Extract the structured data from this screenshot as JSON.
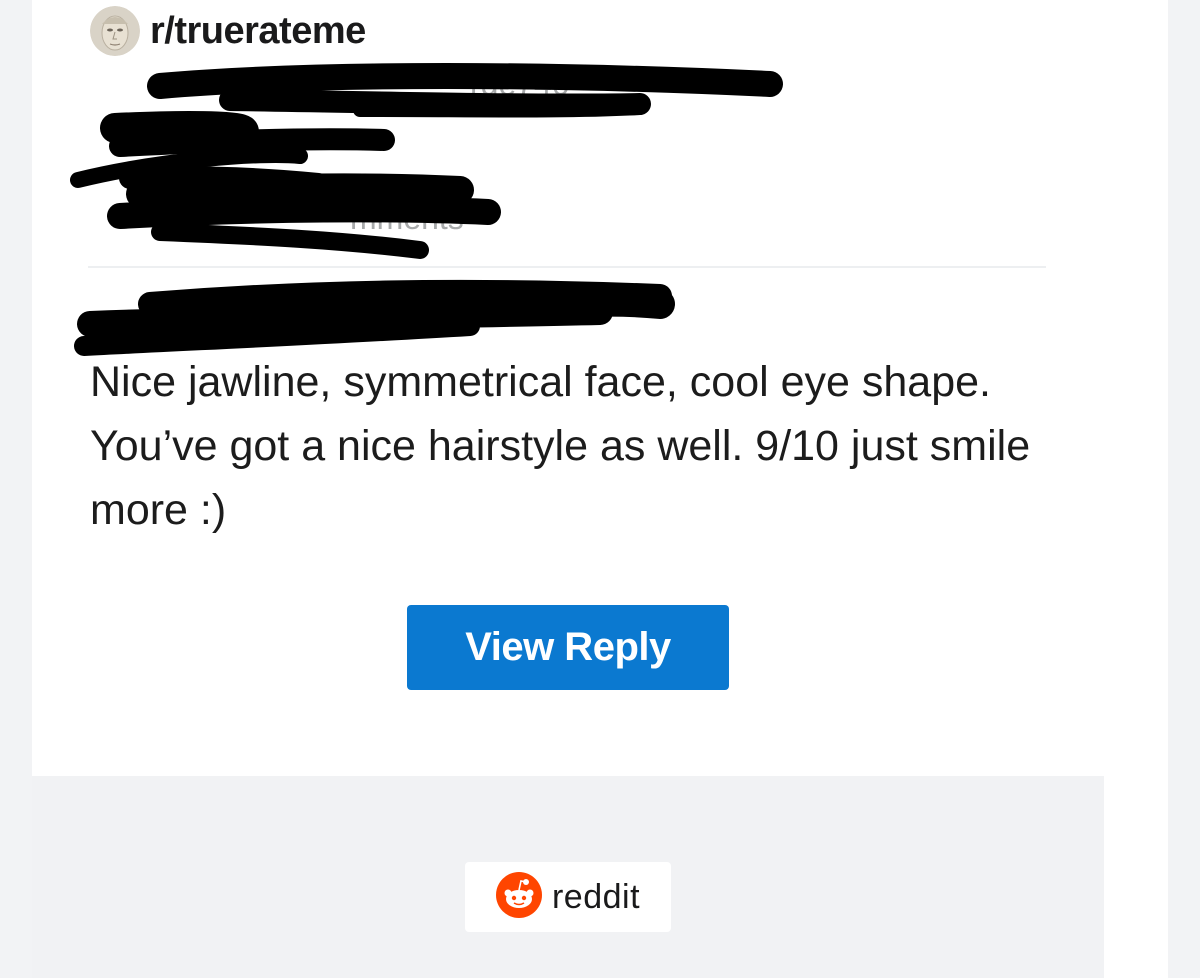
{
  "header": {
    "subreddit": "r/truerateme",
    "avatar_icon": "face-avatar-icon"
  },
  "redacted_fragments": {
    "username_fragment": "rge740",
    "comments_fragment": "mments"
  },
  "reply": {
    "body": "Nice jawline, symmetrical face, cool eye shape. You’ve got a nice hairstyle as well. 9/10 just smile more :)"
  },
  "actions": {
    "view_reply_label": "View Reply"
  },
  "footer": {
    "brand_label": "reddit",
    "brand_icon": "reddit-snoo-icon"
  },
  "colors": {
    "button": "#0b79d0",
    "reddit_orange": "#ff4500",
    "footer_bg": "#f1f2f4"
  }
}
